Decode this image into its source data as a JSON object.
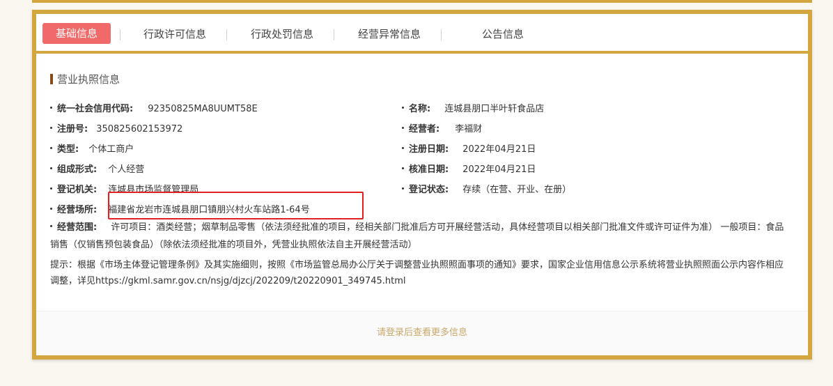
{
  "tabs": [
    {
      "label": "基础信息",
      "active": true
    },
    {
      "label": "行政许可信息"
    },
    {
      "label": "行政处罚信息"
    },
    {
      "label": "经营异常信息"
    },
    {
      "label": "公告信息"
    }
  ],
  "section_title": "营业执照信息",
  "fields": {
    "credit_code": {
      "label": "统一社会信用代码:",
      "value": "92350825MA8UUMT58E"
    },
    "name": {
      "label": "名称:",
      "value": "连城县朋口半叶轩食品店"
    },
    "reg_no": {
      "label": "注册号:",
      "value": "350825602153972"
    },
    "operator": {
      "label": "经营者:",
      "value": "李福财"
    },
    "type": {
      "label": "类型:",
      "value": "个体工商户"
    },
    "reg_date": {
      "label": "注册日期:",
      "value": "2022年04月21日"
    },
    "form": {
      "label": "组成形式:",
      "value": "个人经营"
    },
    "approve_date": {
      "label": "核准日期:",
      "value": "2022年04月21日"
    },
    "authority": {
      "label": "登记机关:",
      "value": "连城县市场监督管理局"
    },
    "status": {
      "label": "登记状态:",
      "value": "存续（在营、开业、在册）"
    },
    "address": {
      "label": "经营场所:",
      "value": "福建省龙岩市连城县朋口镇朋兴村火车站路1-64号"
    },
    "scope": {
      "label": "经营范围:",
      "value": "许可项目：酒类经营；烟草制品零售（依法须经批准的项目，经相关部门批准后方可开展经营活动，具体经营项目以相关部门批准文件或许可证件为准） 一般项目：食品销售（仅销售预包装食品）（除依法须经批准的项目外，凭营业执照依法自主开展经营活动）"
    }
  },
  "tip": "提示：根据《市场主体登记管理条例》及其实施细则，按照《市场监管总局办公厅关于调整营业执照照面事项的通知》要求，国家企业信用信息公示系统将营业执照照面公示内容作相应调整，详见https://gkml.samr.gov.cn/nsjg/djzcj/202209/t20220901_349745.html",
  "login_prompt": "请登录后查看更多信息",
  "colors": {
    "frame": "#d4a640",
    "active_tab": "#f06a6a",
    "highlight": "#e02020",
    "login_text": "#c9a769"
  }
}
